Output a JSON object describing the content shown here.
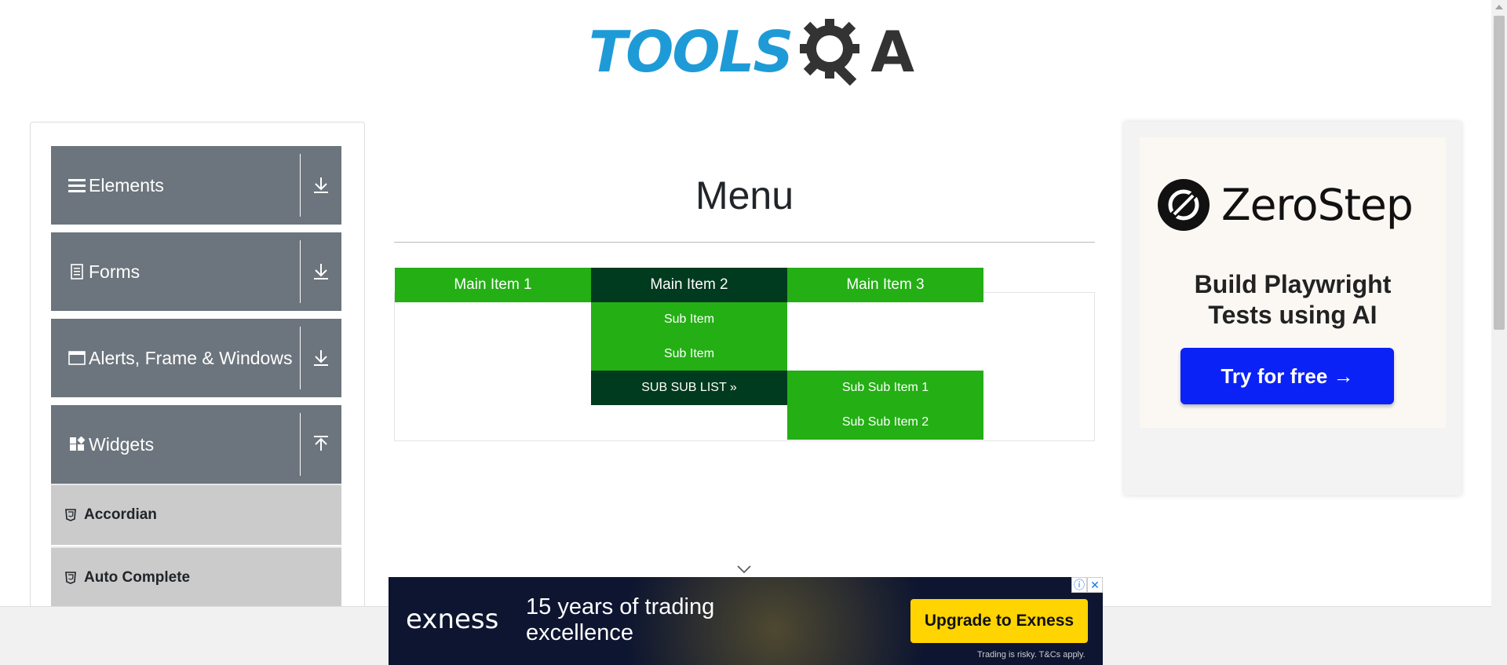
{
  "header": {
    "logo_text": "TOOLS",
    "logo_suffix": "A"
  },
  "sidebar": {
    "groups": [
      {
        "label": "Elements",
        "icon": "hamburger-icon",
        "arrow": "download-arrow-icon"
      },
      {
        "label": "Forms",
        "icon": "document-icon",
        "arrow": "download-arrow-icon"
      },
      {
        "label": "Alerts, Frame & Windows",
        "icon": "window-icon",
        "arrow": "download-arrow-icon"
      },
      {
        "label": "Widgets",
        "icon": "widgets-icon",
        "arrow": "upload-arrow-icon"
      }
    ],
    "widget_items": [
      {
        "label": "Accordian",
        "icon": "html5-icon"
      },
      {
        "label": "Auto Complete",
        "icon": "html5-icon"
      }
    ]
  },
  "main": {
    "title": "Menu",
    "menu": {
      "main_items": [
        "Main Item 1",
        "Main Item 2",
        "Main Item 3"
      ],
      "sub_items": [
        "Sub Item",
        "Sub Item",
        "SUB SUB LIST »"
      ],
      "sub_sub_items": [
        "Sub Sub Item 1",
        "Sub Sub Item 2"
      ]
    }
  },
  "ads": {
    "right": {
      "brand": "ZeroStep",
      "tagline_1": "Build Playwright",
      "tagline_2": "Tests using AI",
      "button": "Try for free →"
    },
    "bottom": {
      "brand": "exness",
      "headline_1": "15 years of trading",
      "headline_2": "excellence",
      "button": "Upgrade to Exness",
      "fine_print": "Trading is risky. T&Cs apply.",
      "info_label": "ⓘ",
      "close_label": "✕"
    }
  },
  "colors": {
    "menu_green": "#24af15",
    "menu_dark": "#003a1f",
    "sidebar_group": "#6c757d",
    "sidebar_item": "#cbcbcb",
    "zerostep_button": "#0a22f5",
    "exness_button": "#ffd400"
  }
}
